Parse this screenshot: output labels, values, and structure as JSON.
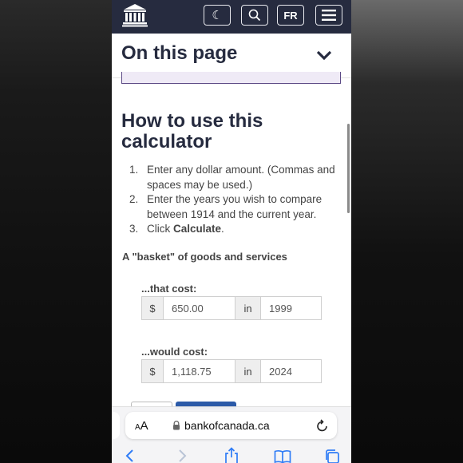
{
  "header": {
    "lang_toggle": "FR",
    "icons": [
      "bank-logo-icon",
      "moon-icon",
      "search-icon",
      "menu-icon"
    ]
  },
  "on_this_page": {
    "title": "On this page"
  },
  "section": {
    "heading": "How to use this calculator"
  },
  "steps": [
    {
      "num": "1.",
      "text": "Enter any dollar amount. (Commas and spaces may be used.)"
    },
    {
      "num": "2.",
      "text": "Enter the years you wish to compare between 1914 and the current year."
    },
    {
      "num": "3.",
      "text_prefix": "Click ",
      "text_bold": "Calculate",
      "text_suffix": "."
    }
  ],
  "basket_label": "A \"basket\" of goods and services",
  "that_cost": {
    "label": "...that cost:",
    "currency": "$",
    "amount": "650.00",
    "in_label": "in",
    "year": "1999"
  },
  "would_cost": {
    "label": "...would cost:",
    "currency": "$",
    "amount": "1,118.75",
    "in_label": "in",
    "year": "2024"
  },
  "browser": {
    "aa_label_small": "A",
    "aa_label_large": "A",
    "url": "bankofcanada.ca"
  },
  "colors": {
    "header_bg": "#262b3f",
    "heading_text": "#262b3f",
    "accent_purple": "#5c4a86",
    "button_blue": "#2b5aa8"
  }
}
